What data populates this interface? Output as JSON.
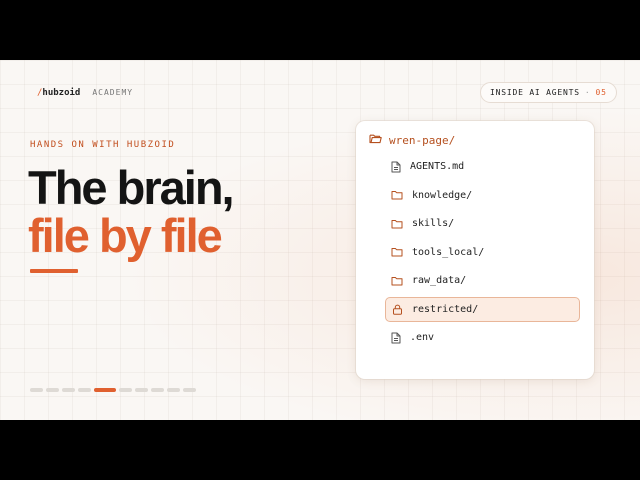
{
  "brand": {
    "slash": "/",
    "name": "hubzoid",
    "academy": "ACADEMY"
  },
  "series_pill": {
    "label": "INSIDE AI AGENTS",
    "separator": "·",
    "number": "05"
  },
  "kicker": "HANDS ON WITH HUBZOID",
  "title": {
    "line1": "The brain,",
    "line2": "file by file"
  },
  "progress": {
    "total": 10,
    "current": 5
  },
  "tree": {
    "root": "wren-page/",
    "items": [
      {
        "name": "AGENTS.md",
        "icon": "file-icon"
      },
      {
        "name": "knowledge/",
        "icon": "folder-icon"
      },
      {
        "name": "skills/",
        "icon": "folder-icon"
      },
      {
        "name": "tools_local/",
        "icon": "folder-icon"
      },
      {
        "name": "raw_data/",
        "icon": "folder-icon"
      },
      {
        "name": "restricted/",
        "icon": "lock-icon",
        "selected": true
      },
      {
        "name": ".env",
        "icon": "file-icon"
      }
    ]
  },
  "colors": {
    "accent": "#e0602f",
    "background": "#faf7f4",
    "selected_bg": "#fcece2"
  }
}
